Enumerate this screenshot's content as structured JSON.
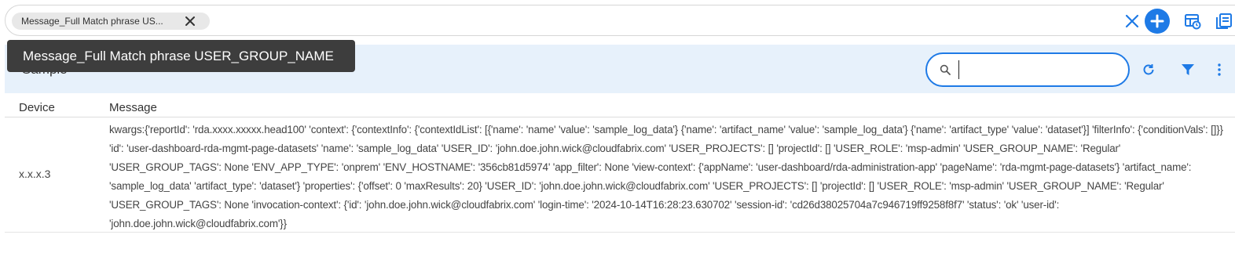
{
  "filter_bar": {
    "chip_label": "Message_Full Match phrase US...",
    "add_icon": "plus-circle-icon",
    "clear_icon": "close-icon",
    "accent": "#1e7ae6"
  },
  "tooltip": {
    "text": "Message_Full Match phrase USER_GROUP_NAME"
  },
  "panel": {
    "title": "Sample",
    "search": {
      "value": "",
      "placeholder": ""
    },
    "icons": [
      "search-icon",
      "refresh-icon",
      "filter-icon",
      "more-vertical-icon"
    ]
  },
  "table": {
    "columns": [
      "Device",
      "Message"
    ],
    "rows": [
      {
        "device": "x.x.x.3",
        "message": "kwargs:{'reportId': 'rda.xxxx.xxxxx.head100' 'context': {'contextInfo': {'contextIdList': [{'name': 'name' 'value': 'sample_log_data'} {'name': 'artifact_name' 'value': 'sample_log_data'} {'name': 'artifact_type' 'value': 'dataset'}] 'filterInfo': {'conditionVals': []}} 'id': 'user-dashboard-rda-mgmt-page-datasets' 'name': 'sample_log_data' 'USER_ID': 'john.doe.john.wick@cloudfabrix.com' 'USER_PROJECTS': [] 'projectId': [] 'USER_ROLE': 'msp-admin' 'USER_GROUP_NAME': 'Regular' 'USER_GROUP_TAGS': None 'ENV_APP_TYPE': 'onprem' 'ENV_HOSTNAME': '356cb81d5974' 'app_filter': None 'view-context': {'appName': 'user-dashboard/rda-administration-app' 'pageName': 'rda-mgmt-page-datasets'} 'artifact_name': 'sample_log_data' 'artifact_type': 'dataset'} 'properties': {'offset': 0 'maxResults': 20} 'USER_ID': 'john.doe.john.wick@cloudfabrix.com' 'USER_PROJECTS': [] 'projectId': [] 'USER_ROLE': 'msp-admin' 'USER_GROUP_NAME': 'Regular' 'USER_GROUP_TAGS': None 'invocation-context': {'id': 'john.doe.john.wick@cloudfabrix.com' 'login-time': '2024-10-14T16:28:23.630702' 'session-id': 'cd26d38025704a7c946719ff9258f8f7' 'status': 'ok' 'user-id': 'john.doe.john.wick@cloudfabrix.com'}}"
      }
    ]
  }
}
